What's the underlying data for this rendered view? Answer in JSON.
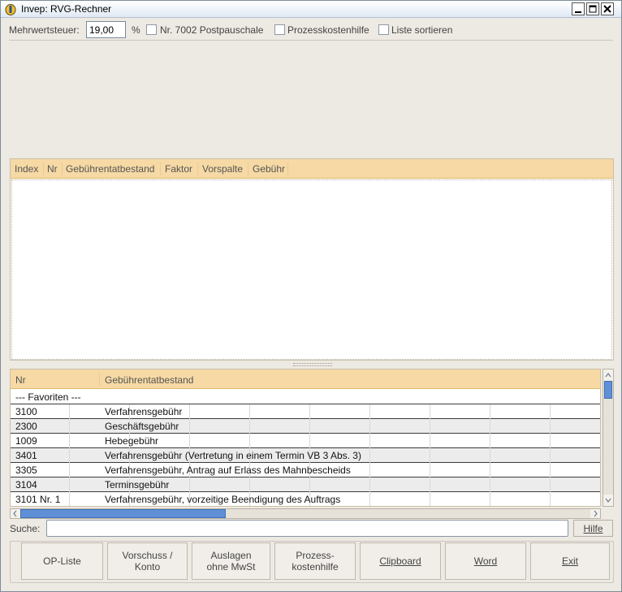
{
  "window": {
    "title": "Invep: RVG-Rechner"
  },
  "options": {
    "mwst_label": "Mehrwertsteuer:",
    "mwst_value": "19,00",
    "mwst_unit": "%",
    "postpauschale_label": "Nr. 7002 Postpauschale",
    "postpauschale_checked": false,
    "pkh_label": "Prozesskostenhilfe",
    "pkh_checked": false,
    "sort_label": "Liste sortieren",
    "sort_checked": false
  },
  "result_table": {
    "columns": [
      "Index",
      "Nr",
      "Gebührentatbestand",
      "Faktor",
      "Vorspalte",
      "Gebühr"
    ],
    "rows": []
  },
  "catalog_table": {
    "columns": [
      "Nr",
      "Gebührentatbestand"
    ],
    "rows": [
      {
        "nr": "--- Favoriten ---",
        "text": ""
      },
      {
        "nr": "3100",
        "text": "Verfahrensgebühr"
      },
      {
        "nr": "2300",
        "text": "Geschäftsgebühr"
      },
      {
        "nr": "1009",
        "text": "Hebegebühr"
      },
      {
        "nr": "3401",
        "text": "Verfahrensgebühr (Vertretung in einem Termin VB 3 Abs. 3)"
      },
      {
        "nr": "3305",
        "text": "Verfahrensgebühr, Antrag auf Erlass des Mahnbescheids"
      },
      {
        "nr": "3104",
        "text": "Terminsgebühr"
      },
      {
        "nr": "3101 Nr. 1",
        "text": "Verfahrensgebühr, vorzeitige Beendigung des Auftrags"
      }
    ]
  },
  "search": {
    "label": "Suche:",
    "value": "",
    "help_label": "Hilfe"
  },
  "buttons": {
    "op_liste": "OP-Liste",
    "vorschuss": "Vorschuss /\nKonto",
    "auslagen": "Auslagen\nohne MwSt",
    "pkh": "Prozess-\nkostenhilfe",
    "clipboard": "Clipboard",
    "word": "Word",
    "exit": "Exit"
  },
  "colors": {
    "header_bg": "#f6d9a4",
    "window_bg": "#ede9e3",
    "scroll_thumb": "#5f90d6"
  }
}
